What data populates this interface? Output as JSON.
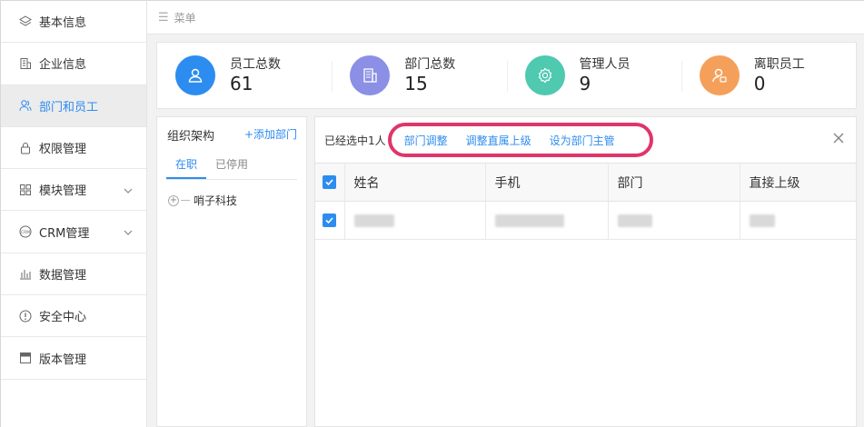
{
  "sidebar": {
    "items": [
      {
        "label": "基本信息",
        "icon": "layers-icon",
        "active": false
      },
      {
        "label": "企业信息",
        "icon": "building-icon",
        "active": false
      },
      {
        "label": "部门和员工",
        "icon": "users-icon",
        "active": true
      },
      {
        "label": "权限管理",
        "icon": "lock-icon",
        "active": false
      },
      {
        "label": "模块管理",
        "icon": "grid-icon",
        "active": false
      },
      {
        "label": "CRM管理",
        "icon": "crm-icon",
        "active": false
      },
      {
        "label": "数据管理",
        "icon": "bar-chart-icon",
        "active": false
      },
      {
        "label": "安全中心",
        "icon": "alert-icon",
        "active": false
      },
      {
        "label": "版本管理",
        "icon": "version-icon",
        "active": false
      }
    ]
  },
  "topbar": {
    "menu_label": "菜单"
  },
  "stats": [
    {
      "label": "员工总数",
      "value": "61",
      "color": "#2d8cf0",
      "icon": "person-icon"
    },
    {
      "label": "部门总数",
      "value": "15",
      "color": "#8b8fe6",
      "icon": "building-icon"
    },
    {
      "label": "管理人员",
      "value": "9",
      "color": "#4fc9b0",
      "icon": "gear-icon"
    },
    {
      "label": "离职员工",
      "value": "0",
      "color": "#f5a05a",
      "icon": "person-leave-icon"
    }
  ],
  "org": {
    "title": "组织架构",
    "add_label": "+添加部门",
    "tabs": [
      {
        "label": "在职",
        "active": true
      },
      {
        "label": "已停用",
        "active": false
      }
    ],
    "tree_root": "哨子科技",
    "tree_toggle": "+"
  },
  "main": {
    "selection_info": "已经选中1人",
    "actions": [
      "部门调整",
      "调整直属上级",
      "设为部门主管"
    ],
    "highlight_color": "#e0356a",
    "columns": [
      "姓名",
      "手机",
      "部门",
      "直接上级"
    ]
  },
  "colors": {
    "accent": "#2d8cf0"
  }
}
